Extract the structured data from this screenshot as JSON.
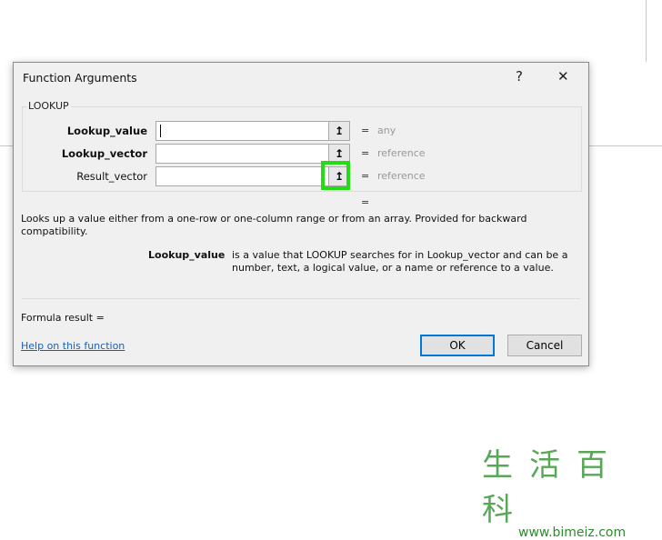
{
  "dialog": {
    "title": "Function Arguments",
    "help_btn": "?",
    "close_btn": "✕",
    "function_name": "LOOKUP",
    "args": [
      {
        "label": "Lookup_value",
        "bold": true,
        "value": "",
        "result": "any"
      },
      {
        "label": "Lookup_vector",
        "bold": true,
        "value": "",
        "result": "reference"
      },
      {
        "label": "Result_vector",
        "bold": false,
        "value": "",
        "result": "reference"
      }
    ],
    "ref_icon": "↥",
    "equals": "=",
    "description": "Looks up a value either from a one-row or one-column range or from an array. Provided for backward compatibility.",
    "arg_name": "Lookup_value",
    "arg_desc": "is a value that LOOKUP searches for in Lookup_vector and can be a number, text, a logical value, or a name or reference to a value.",
    "formula_result": "Formula result =",
    "help_link": "Help on this function",
    "ok": "OK",
    "cancel": "Cancel"
  },
  "watermark": {
    "chars": "生活百科",
    "url": "www.bimeiz.com"
  },
  "colors": {
    "highlight": "#22dd11"
  }
}
